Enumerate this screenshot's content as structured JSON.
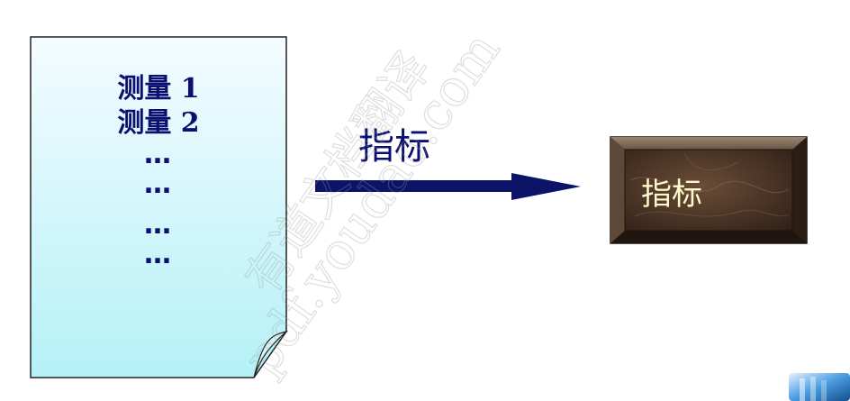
{
  "document": {
    "lines": [
      "测量 1",
      "测量 2"
    ],
    "dots": [
      "…",
      "…",
      "…",
      "…"
    ]
  },
  "arrow": {
    "label": "指标"
  },
  "target": {
    "label": "指标"
  },
  "watermark": {
    "lines": [
      "有道文档翻译",
      "pdf.youdao.com"
    ]
  },
  "colors": {
    "text": "#0b1070",
    "arrow": "#0c1468",
    "doc_fill_top": "#f2fbff",
    "doc_fill_bottom": "#b7f2f8",
    "marble_base": "#4a3426",
    "target_text": "#fff8c8"
  }
}
